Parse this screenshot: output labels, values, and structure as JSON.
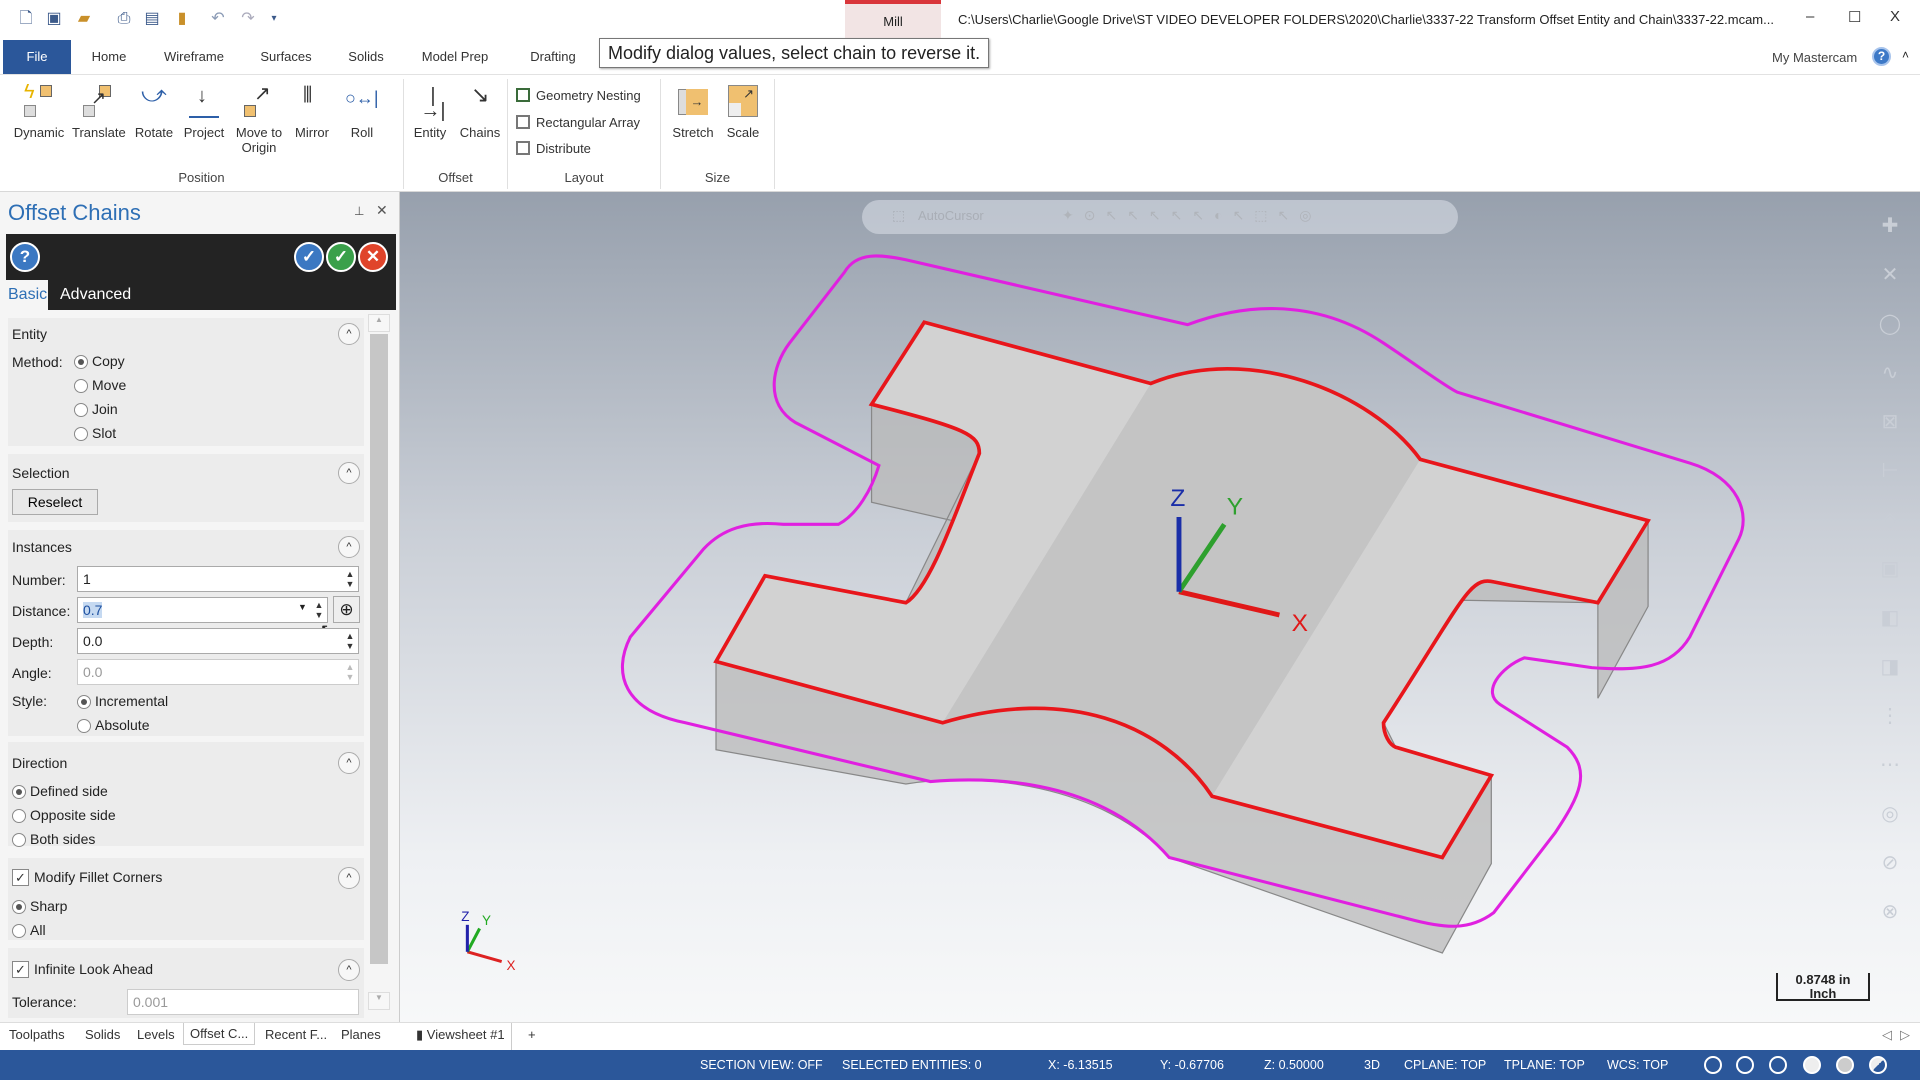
{
  "titlebar": {
    "context_tab": "Mill",
    "file_path": "C:\\Users\\Charlie\\Google Drive\\ST VIDEO DEVELOPER FOLDERS\\2020\\Charlie\\3337-22 Transform Offset Entity and Chain\\3337-22.mcam...",
    "minimize": "–",
    "maximize": "☐",
    "close": "X"
  },
  "menu_tabs": [
    "File",
    "Home",
    "Wireframe",
    "Surfaces",
    "Solids",
    "Model Prep",
    "Drafting"
  ],
  "tooltip": "Modify dialog values, select chain to reverse it.",
  "my_mastercam": "My Mastercam",
  "ribbon": {
    "position": {
      "label": "Position",
      "items": [
        "Dynamic",
        "Translate",
        "Rotate",
        "Project",
        "Move to Origin",
        "Mirror",
        "Roll"
      ]
    },
    "offset": {
      "label": "Offset",
      "items": [
        "Entity",
        "Chains"
      ]
    },
    "layout": {
      "label": "Layout",
      "items": [
        "Geometry Nesting",
        "Rectangular Array",
        "Distribute"
      ]
    },
    "size": {
      "label": "Size",
      "items": [
        "Stretch",
        "Scale"
      ]
    }
  },
  "panel": {
    "title": "Offset Chains",
    "tabs": [
      "Basic",
      "Advanced"
    ],
    "entity": {
      "heading": "Entity",
      "method_label": "Method:",
      "options": [
        "Copy",
        "Move",
        "Join",
        "Slot"
      ],
      "selected": "Copy"
    },
    "selection": {
      "heading": "Selection",
      "reselect": "Reselect"
    },
    "instances": {
      "heading": "Instances",
      "number_label": "Number:",
      "number": "1",
      "distance_label": "Distance:",
      "distance": "0.7",
      "depth_label": "Depth:",
      "depth": "0.0",
      "angle_label": "Angle:",
      "angle": "0.0",
      "style_label": "Style:",
      "style_options": [
        "Incremental",
        "Absolute"
      ],
      "style_selected": "Incremental"
    },
    "direction": {
      "heading": "Direction",
      "options": [
        "Defined side",
        "Opposite side",
        "Both sides"
      ],
      "selected": "Defined side"
    },
    "fillet": {
      "heading": "Modify Fillet Corners",
      "checked": true,
      "options": [
        "Sharp",
        "All"
      ],
      "selected": "Sharp"
    },
    "lookahead": {
      "heading": "Infinite Look Ahead",
      "checked": true,
      "tolerance_label": "Tolerance:",
      "tolerance": "0.001"
    }
  },
  "viewport": {
    "autocursor": "AutoCursor",
    "axis_x": "X",
    "axis_y": "Y",
    "axis_z": "Z",
    "scale_value": "0.8748 in",
    "scale_unit": "Inch",
    "colors": {
      "chain": "#e8161b",
      "offset": "#e020e0"
    }
  },
  "bottom_tabs": [
    "Toolpaths",
    "Solids",
    "Levels",
    "Offset C...",
    "Recent F...",
    "Planes"
  ],
  "viewsheet": {
    "tab": "Viewsheet #1",
    "add": "+"
  },
  "status": {
    "section_view": "SECTION VIEW: OFF",
    "selected": "SELECTED ENTITIES: 0",
    "x": "X:  -6.13515",
    "y": "Y:  -0.67706",
    "z": "Z:  0.50000",
    "mode": "3D",
    "cplane": "CPLANE: TOP",
    "tplane": "TPLANE: TOP",
    "wcs": "WCS: TOP"
  }
}
